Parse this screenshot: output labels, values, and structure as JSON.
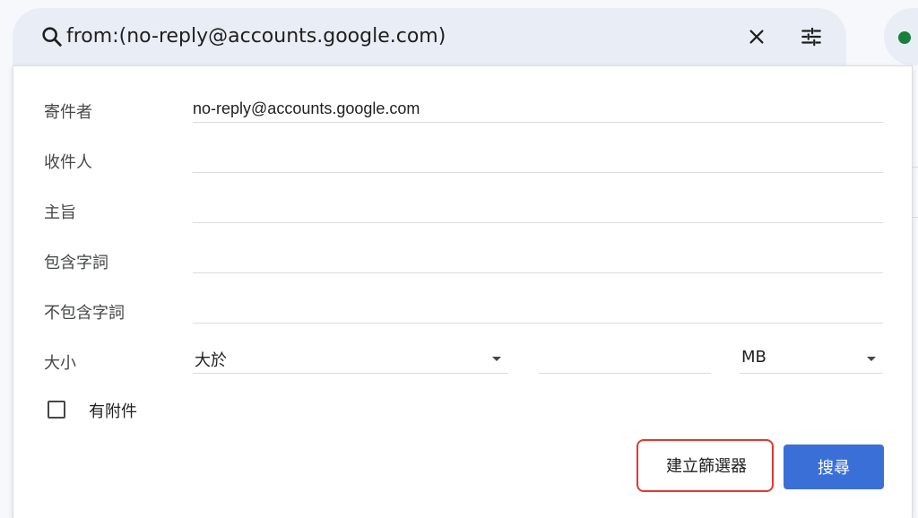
{
  "search": {
    "query": "from:(no-reply@accounts.google.com)"
  },
  "icons": {
    "search": "search-icon",
    "clear": "close-icon",
    "options": "tune-icon",
    "status": "status-dot"
  },
  "form": {
    "from_label": "寄件者",
    "from_value": "no-reply@accounts.google.com",
    "to_label": "收件人",
    "to_value": "",
    "subject_label": "主旨",
    "subject_value": "",
    "has_words_label": "包含字詞",
    "has_words_value": "",
    "no_words_label": "不包含字詞",
    "no_words_value": "",
    "size_label": "大小",
    "size_comparator": "大於",
    "size_value": "",
    "size_unit": "MB",
    "attachment_label": "有附件",
    "attachment_checked": false
  },
  "actions": {
    "create_filter_label": "建立篩選器",
    "search_label": "搜尋"
  },
  "colors": {
    "primary_button": "#3b6fd8",
    "highlight": "#e5382c",
    "status_online": "#188038"
  }
}
